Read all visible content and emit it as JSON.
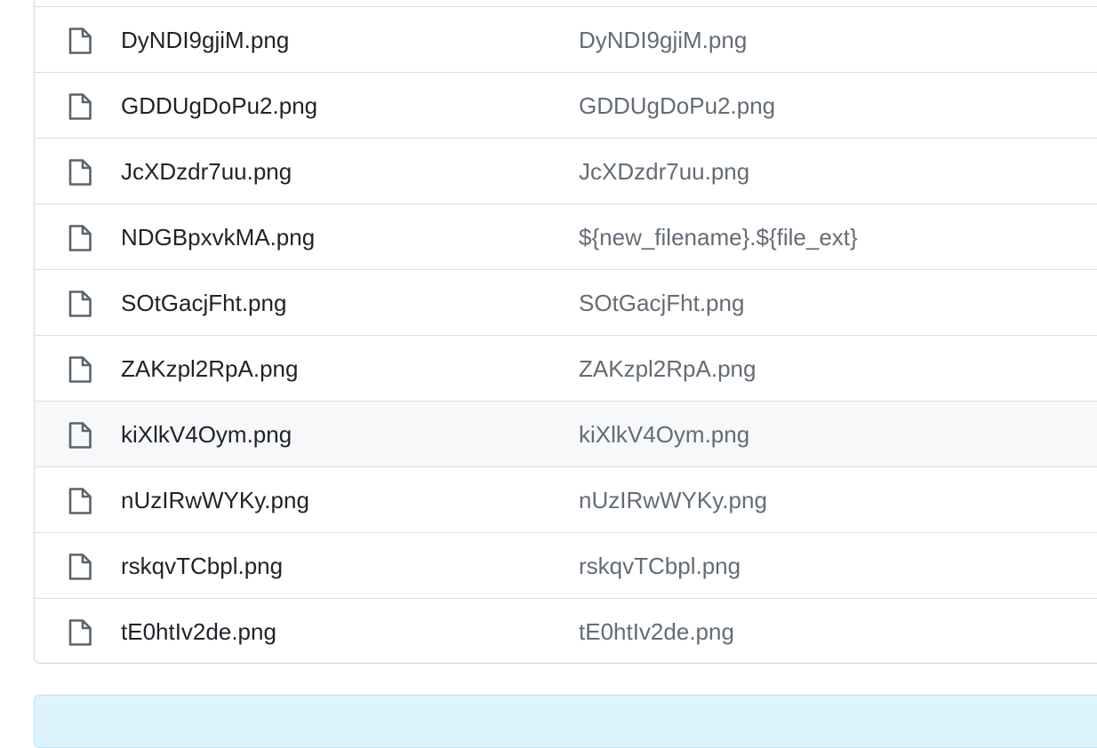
{
  "files": [
    {
      "name": "DyNDI9gjiM.png",
      "message": "DyNDI9gjiM.png",
      "highlighted": false
    },
    {
      "name": "GDDUgDoPu2.png",
      "message": "GDDUgDoPu2.png",
      "highlighted": false
    },
    {
      "name": "JcXDzdr7uu.png",
      "message": "JcXDzdr7uu.png",
      "highlighted": false
    },
    {
      "name": "NDGBpxvkMA.png",
      "message": "${new_filename}.${file_ext}",
      "highlighted": false
    },
    {
      "name": "SOtGacjFht.png",
      "message": "SOtGacjFht.png",
      "highlighted": false
    },
    {
      "name": "ZAKzpl2RpA.png",
      "message": "ZAKzpl2RpA.png",
      "highlighted": false
    },
    {
      "name": "kiXlkV4Oym.png",
      "message": "kiXlkV4Oym.png",
      "highlighted": true
    },
    {
      "name": "nUzIRwWYKy.png",
      "message": "nUzIRwWYKy.png",
      "highlighted": false
    },
    {
      "name": "rskqvTCbpl.png",
      "message": "rskqvTCbpl.png",
      "highlighted": false
    },
    {
      "name": "tE0htIv2de.png",
      "message": "tE0htIv2de.png",
      "highlighted": false
    }
  ],
  "icons": {
    "row_icon": "file-icon"
  },
  "colors": {
    "file_name": "#1f2328",
    "commit_message": "#636c76",
    "row_border": "#d8dee4",
    "hover_row": "#f6f8fa",
    "banner_bg": "#ddf4ff"
  }
}
